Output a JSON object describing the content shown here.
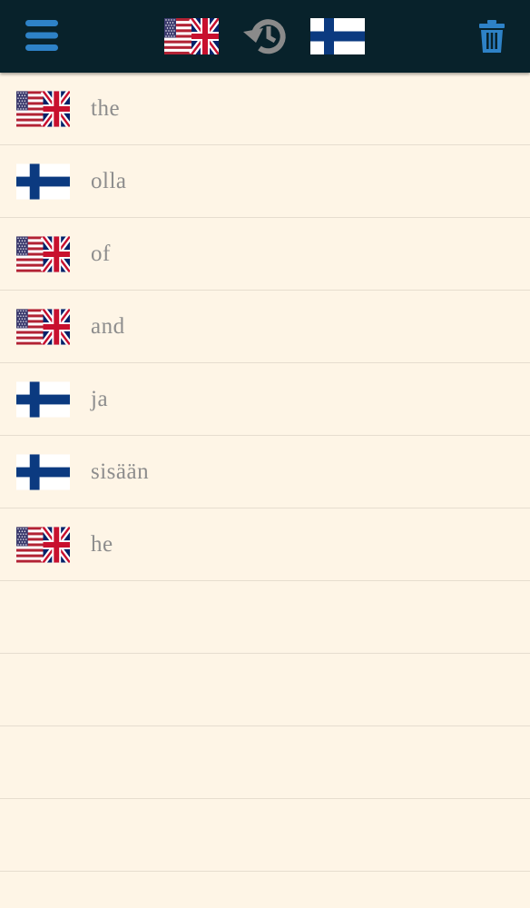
{
  "toolbar": {
    "menu_icon": "hamburger-menu-icon",
    "source_language_icon": "us-uk-flag-icon",
    "history_icon": "history-icon",
    "target_language_icon": "finland-flag-icon",
    "trash_icon": "trash-icon"
  },
  "colors": {
    "topbar_bg": "#08222b",
    "accent_blue": "#2e82c7",
    "history_gray": "#8a8a8a",
    "list_bg": "#fef5e6",
    "word_text": "#8d8d8d",
    "finland_blue": "#0b3a80"
  },
  "history": {
    "items": [
      {
        "lang": "en",
        "flag": "us-uk-flag-icon",
        "word": "the"
      },
      {
        "lang": "fi",
        "flag": "finland-flag-icon",
        "word": "olla"
      },
      {
        "lang": "en",
        "flag": "us-uk-flag-icon",
        "word": "of"
      },
      {
        "lang": "en",
        "flag": "us-uk-flag-icon",
        "word": "and"
      },
      {
        "lang": "fi",
        "flag": "finland-flag-icon",
        "word": "ja"
      },
      {
        "lang": "fi",
        "flag": "finland-flag-icon",
        "word": "sisään"
      },
      {
        "lang": "en",
        "flag": "us-uk-flag-icon",
        "word": "he"
      }
    ]
  }
}
